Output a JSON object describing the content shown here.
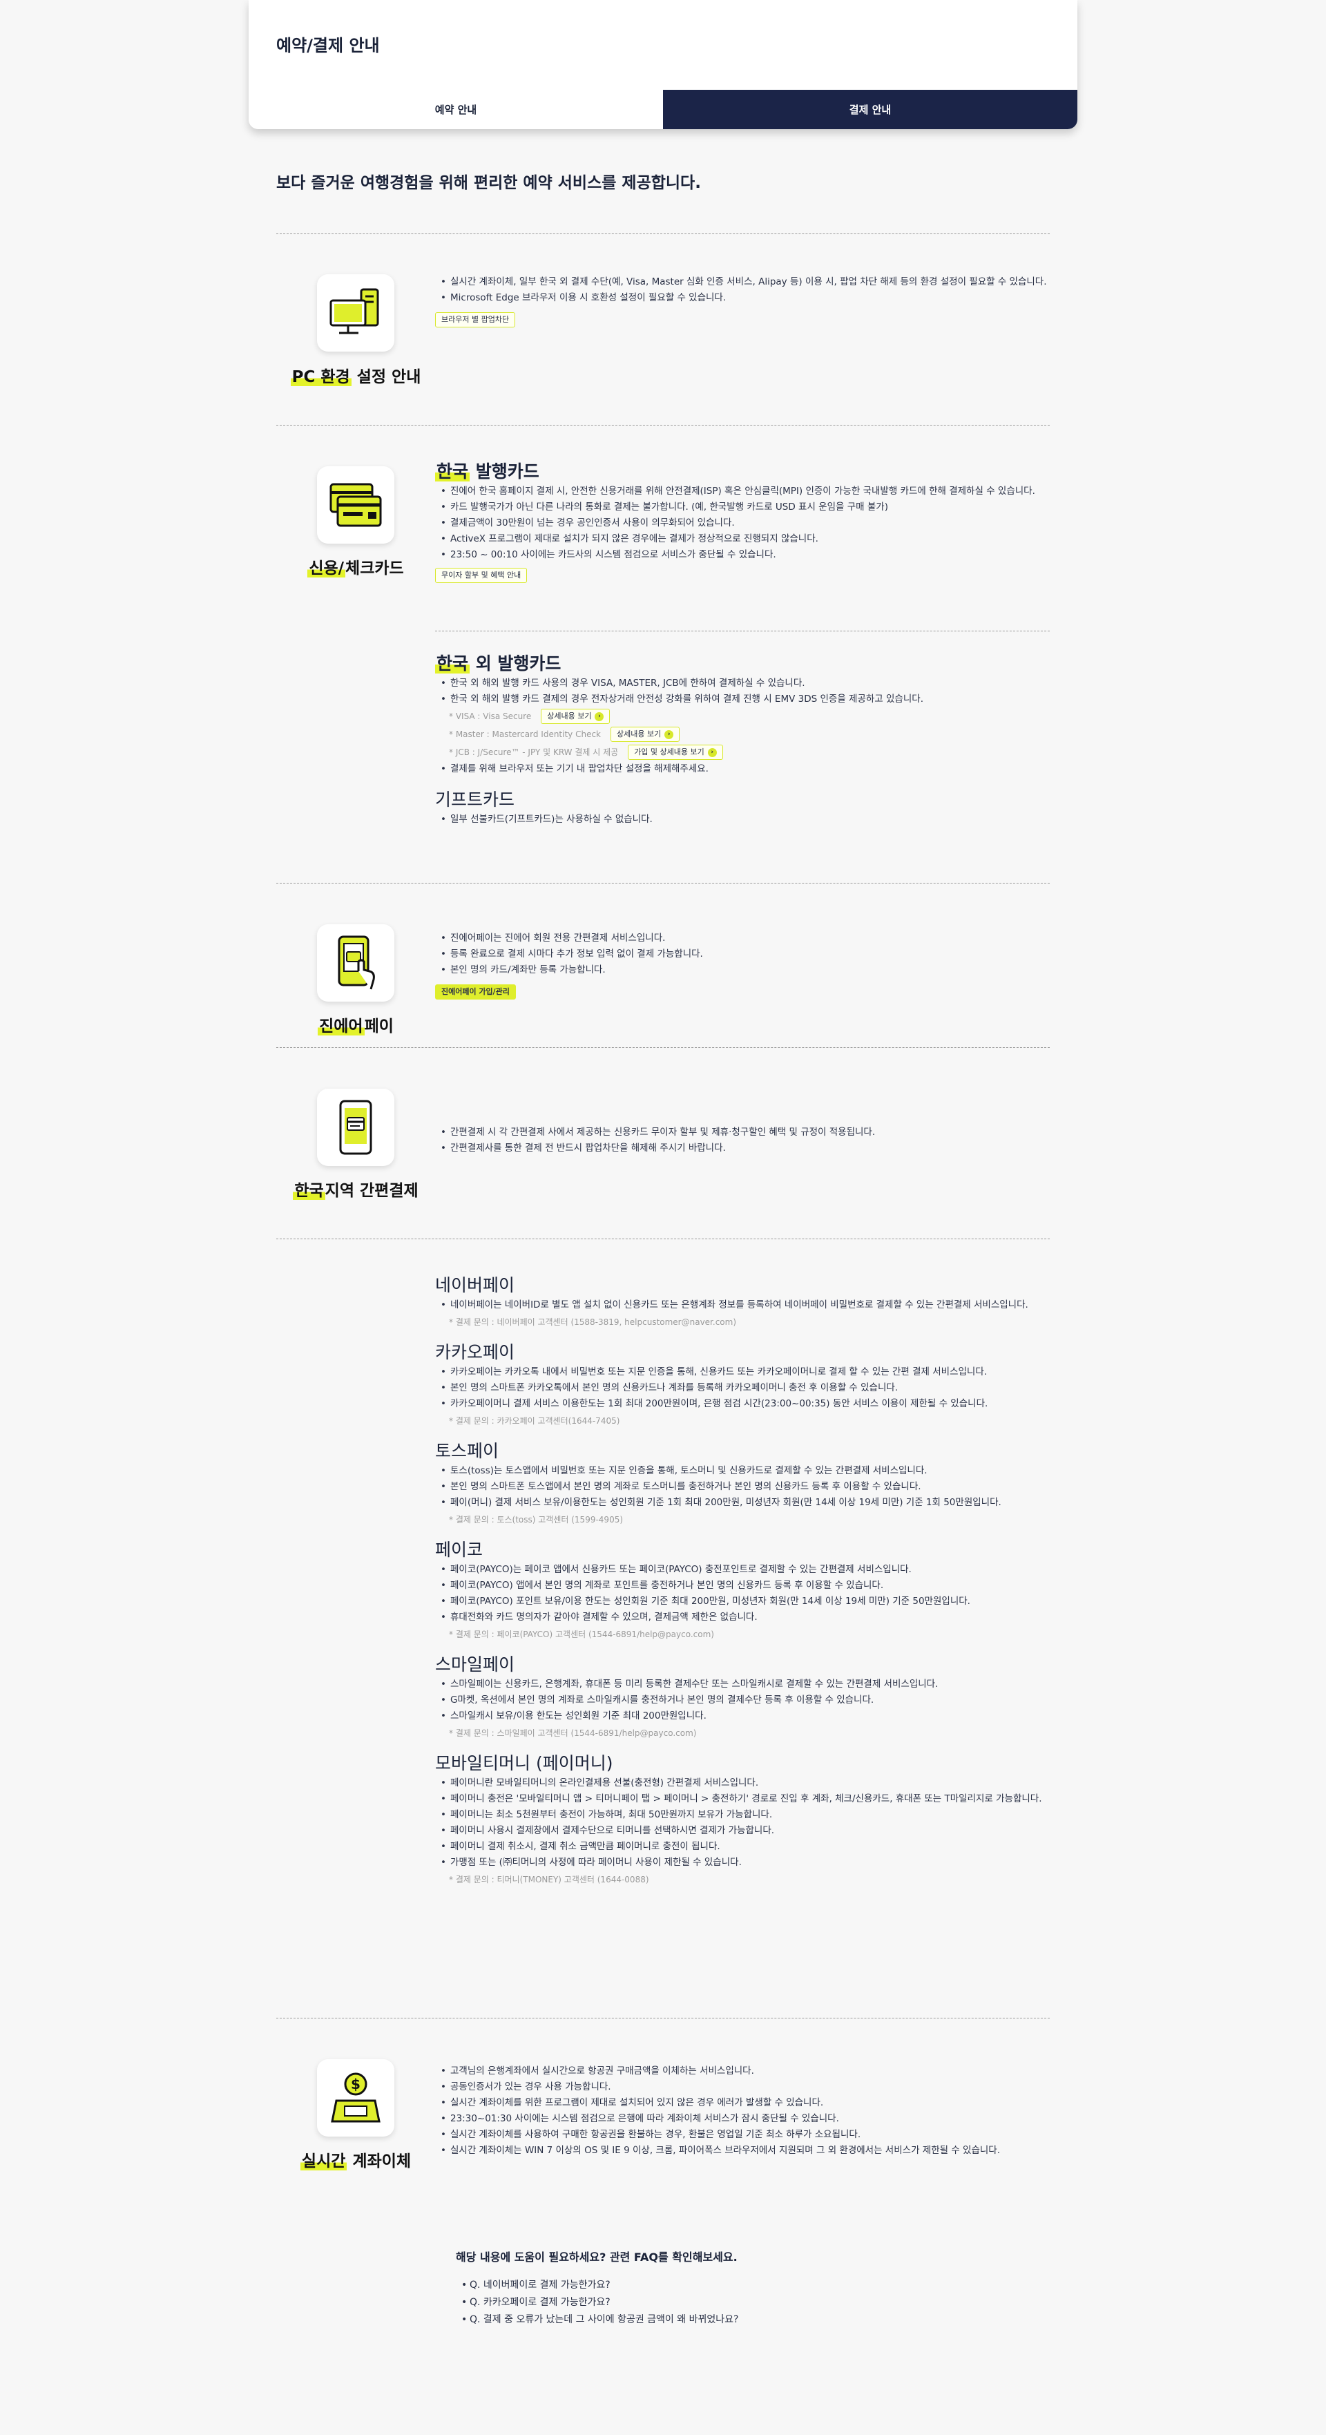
{
  "header": {
    "title": "예약/결제 안내",
    "tabs": [
      {
        "label": "예약 안내",
        "active": false
      },
      {
        "label": "결제 안내",
        "active": true
      }
    ]
  },
  "intro": "보다 즐거운 여행경험을 위해 편리한 예약 서비스를 제공합니다.",
  "colors": {
    "accent": "#dfee2c",
    "navy": "#1b2448",
    "bg": "#f7f7f7"
  },
  "pc_section": {
    "icon": "computer-icon",
    "title_highlight": "PC 환경",
    "title_rest": "설정 안내",
    "bullets": [
      "실시간 계좌이체, 일부 한국 외 결제 수단(예, Visa, Master 심화 인증 서비스, Alipay 등) 이용 시, 팝업 차단 해제 등의 환경 설정이 필요할 수 있습니다.",
      "Microsoft Edge 브라우저 이용 시 호환성 설정이 필요할 수 있습니다."
    ],
    "chip": "브라우저 별 팝업차단"
  },
  "card_section": {
    "icon": "credit-card-icon",
    "title_highlight": "신용/",
    "title_rest": "체크카드",
    "domestic": {
      "heading_highlight": "한국",
      "heading_rest": " 발행카드",
      "bullets": [
        "진에어 한국 홈페이지 결제 시, 안전한 신용거래를 위해 안전결제(ISP) 혹은 안심클릭(MPI) 인증이 가능한 국내발행 카드에 한해 결제하실 수 있습니다.",
        "카드 발행국가가 아닌 다른 나라의 통화로 결제는 불가합니다. (예, 한국발행 카드로 USD 표시 운임을 구매 불가)",
        "결제금액이 30만원이 넘는 경우 공인인증서 사용이 의무화되어 있습니다.",
        "ActiveX 프로그램이 제대로 설치가 되지 않은 경우에는 결제가 정상적으로 진행되지 않습니다.",
        "23:50 ~ 00:10 사이에는 카드사의 시스템 점검으로 서비스가 중단될 수 있습니다."
      ],
      "chip": "무이자 할부 및 혜택 안내"
    },
    "foreign": {
      "heading_highlight": "한국",
      "heading_rest": " 외 발행카드",
      "bullets": [
        "한국 외 해외 발행 카드 사용의 경우 VISA, MASTER, JCB에 한하여 결제하실 수 있습니다.",
        "한국 외 해외 발행 카드 결제의 경우 전자상거래 안전성 강화를 위하여 결제 진행 시 EMV 3DS 인증을 제공하고 있습니다."
      ],
      "notes": [
        {
          "text": "* VISA : Visa Secure",
          "chip": "상세내용 보기"
        },
        {
          "text": "* Master : Mastercard Identity Check",
          "chip": "상세내용 보기"
        },
        {
          "text": "* JCB : J/Secure™ - JPY 및 KRW 결제 시 제공",
          "chip": "가입 및 상세내용 보기"
        }
      ],
      "last_bullet": "결제를 위해 브라우저 또는 기기 내 팝업차단 설정을 해제해주세요."
    },
    "gift": {
      "heading": "기프트카드",
      "bullets": [
        "일부 선불카드(기프트카드)는 사용하실 수 없습니다."
      ]
    }
  },
  "jinair_pay": {
    "icon": "phone-pay-icon",
    "title_highlight": "진에어",
    "title_rest": "페이",
    "bullets": [
      "진에어페이는 진에어 회원 전용 간편결제 서비스입니다.",
      "등록 완료으로 결제 시마다 추가 정보 입력 없이 결제 가능합니다.",
      "본인 명의 카드/계좌만 등록 가능합니다."
    ],
    "chip": "진에어페이 가입/관리"
  },
  "local_pay": {
    "icon": "mobile-card-icon",
    "title_highlight": "한국",
    "title_rest": "지역 간편결제",
    "bullets": [
      "간편결제 시 각 간편결제 사에서 제공하는 신용카드 무이자 할부 및 제휴·청구할인 혜택 및 규정이 적용됩니다.",
      "간편결제사를 통한 결제 전 반드시 팝업차단을 해제해 주시기 바랍니다."
    ],
    "providers": [
      {
        "name": "네이버페이",
        "bullets": [
          "네이버페이는 네이버ID로 별도 앱 설치 없이 신용카드 또는 은행계좌 정보를 등록하여 네이버페이 비밀번호로 결제할 수 있는 간편결제 서비스입니다."
        ],
        "note": "* 결제 문의 : 네이버페이 고객센터 (1588-3819, helpcustomer@naver.com)"
      },
      {
        "name": "카카오페이",
        "bullets": [
          "카카오페이는 카카오톡 내에서 비밀번호 또는 지문 인증을 통해, 신용카드 또는 카카오페이머니로 결제 할 수 있는 간편 결제 서비스입니다.",
          "본인 명의 스마트폰 카카오톡에서 본인 명의 신용카드나 계좌를 등록해 카카오페이머니 충전 후 이용할 수 있습니다.",
          "카카오페이머니 결제 서비스 이용한도는 1회 최대 200만원이며, 은행 점검 시간(23:00~00:35) 동안 서비스 이용이 제한될 수 있습니다."
        ],
        "note": "* 결제 문의 : 카카오페이 고객센터(1644-7405)"
      },
      {
        "name": "토스페이",
        "bullets": [
          "토스(toss)는 토스앱에서 비밀번호 또는 지문 인증을 통해, 토스머니 및 신용카드로 결제할 수 있는 간편결제 서비스입니다.",
          "본인 명의 스마트폰 토스앱에서 본인 명의 계좌로 토스머니를 충전하거나 본인 명의 신용카드 등록 후 이용할 수 있습니다.",
          "페이(머니) 결제 서비스 보유/이용한도는 성인회원 기준 1회 최대 200만원, 미성년자 회원(만 14세 이상 19세 미만) 기준 1회 50만원입니다."
        ],
        "note": "* 결제 문의 : 토스(toss) 고객센터 (1599-4905)"
      },
      {
        "name": "페이코",
        "bullets": [
          "페이코(PAYCO)는 페이코 앱에서 신용카드 또는 페이코(PAYCO) 충전포인트로 결제할 수 있는 간편결제 서비스입니다.",
          "페이코(PAYCO) 앱에서 본인 명의 계좌로 포인트를 충전하거나 본인 명의 신용카드 등록 후 이용할 수 있습니다.",
          "페이코(PAYCO) 포인트 보유/이용 한도는 성인회원 기준 최대 200만원, 미성년자 회원(만 14세 이상 19세 미만) 기준 50만원입니다.",
          "휴대전화와 카드 명의자가 같아야 결제할 수 있으며, 결제금액 제한은 없습니다."
        ],
        "note": "* 결제 문의 : 페이코(PAYCO) 고객센터 (1544-6891/help@payco.com)"
      },
      {
        "name": "스마일페이",
        "bullets": [
          "스마일페이는 신용카드, 은행계좌, 휴대폰 등 미리 등록한 결제수단 또는 스마일캐시로 결제할 수 있는 간편결제 서비스입니다.",
          "G마켓, 옥션에서 본인 명의 계좌로 스마일캐시를 충전하거나 본인 명의 결제수단 등록 후 이용할 수 있습니다.",
          "스마일캐시 보유/이용 한도는 성인회원 기준 최대 200만원입니다."
        ],
        "note": "* 결제 문의 : 스마일페이 고객센터 (1544-6891/help@payco.com)"
      },
      {
        "name": "모바일티머니 (페이머니)",
        "bullets": [
          "페이머니란 모바일티머니의 온라인결제용 선불(충전형) 간편결제 서비스입니다.",
          "페이머니 충전은 '모바일티머니 앱 > 티머니페이 탭 > 페이머니 > 충전하기' 경로로 진입 후 계좌, 체크/신용카드, 휴대폰 또는 T마일리지로 가능합니다.",
          "페이머니는 최소 5천원부터 충전이 가능하며, 최대 50만원까지 보유가 가능합니다.",
          "페이머니 사용시 결제창에서 결제수단으로 티머니를 선택하시면 결제가 가능합니다.",
          "페이머니 결제 취소시, 결제 취소 금액만큼 페이머니로 충전이 됩니다.",
          "가맹점 또는 (㈜티머니의 사정에 따라 페이머니 사용이 제한될 수 있습니다."
        ],
        "note": "* 결제 문의 : 티머니(TMONEY) 고객센터 (1644-0088)"
      }
    ]
  },
  "transfer": {
    "icon": "money-transfer-icon",
    "title_highlight": "실시간",
    "title_rest": " 계좌이체",
    "bullets": [
      "고객님의 은행계좌에서 실시간으로 항공권 구매금액을 이체하는 서비스입니다.",
      "공동인증서가 있는 경우 사용 가능합니다.",
      "실시간 계좌이체를 위한 프로그램이 제대로 설치되어 있지 않은 경우 에러가 발생할 수 있습니다.",
      "23:30~01:30 사이에는 시스템 점검으로 은행에 따라 계좌이체 서비스가 잠시 중단될 수 있습니다.",
      "실시간 계좌이체를 사용하여 구매한 항공권을 환불하는 경우, 환불은 영업일 기준 최소 하루가 소요됩니다.",
      "실시간 계좌이체는 WIN 7 이상의 OS 및 IE 9 이상, 크롬, 파이어폭스 브라우저에서 지원되며 그 외 환경에서는 서비스가 제한될 수 있습니다."
    ]
  },
  "faq": {
    "title": "해당 내용에 도움이 필요하세요? 관련 FAQ를 확인해보세요.",
    "items": [
      "Q. 네이버페이로 결제 가능한가요?",
      "Q. 카카오페이로 결제 가능한가요?",
      "Q. 결제 중 오류가 났는데 그 사이에 항공권 금액이 왜 바뀌었나요?"
    ]
  }
}
